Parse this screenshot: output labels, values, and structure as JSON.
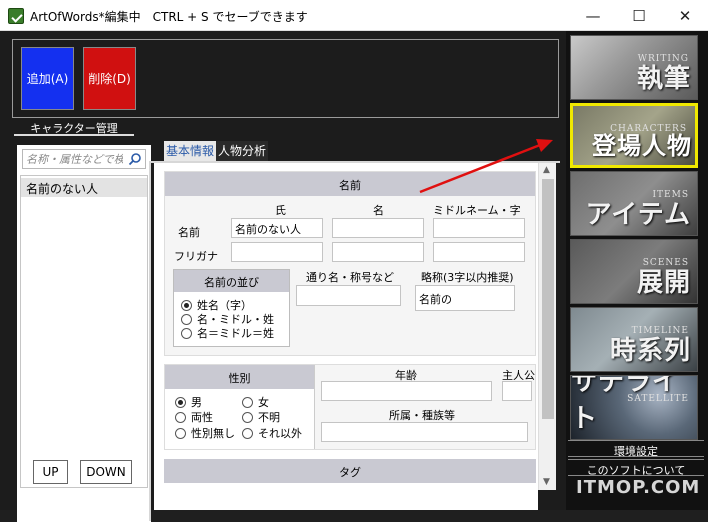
{
  "window": {
    "title": "ArtOfWords*編集中　CTRL + S でセーブできます",
    "minimize": "—",
    "maximize": "☐",
    "close": "✕"
  },
  "toolbar": {
    "add_label": "追加(A)",
    "delete_label": "削除(D)"
  },
  "character_manager": {
    "label": "キャラクター管理",
    "search_placeholder": "名称・属性などで検索",
    "list": [
      "名前のない人"
    ],
    "up_label": "UP",
    "down_label": "DOWN"
  },
  "tabs": [
    {
      "label": "基本情報",
      "active": true
    },
    {
      "label": "人物分析",
      "active": false
    }
  ],
  "name_section": {
    "header": "名前",
    "col_family": "氏",
    "col_given": "名",
    "col_middle": "ミドルネーム・字",
    "row_name": "名前",
    "row_furigana": "フリガナ",
    "family_value": "名前のない人",
    "given_value": "",
    "middle_value": "",
    "furigana_family": "",
    "furigana_given": "",
    "furigana_middle": "",
    "order_title": "名前の並び",
    "order_options": [
      "姓名（字）",
      "名・ミドル・姓",
      "名＝ミドル＝姓"
    ],
    "order_selected": 0,
    "alias_label": "通り名・称号など",
    "alias_value": "",
    "abbr_label": "略称(3字以内推奨)",
    "abbr_value": "名前の"
  },
  "gender_section": {
    "title": "性別",
    "options": [
      "男",
      "女",
      "両性",
      "不明",
      "性別無し",
      "それ以外"
    ],
    "selected": 0,
    "age_label": "年齢",
    "age_value": "",
    "protagonist_label": "主人公",
    "affiliation_label": "所属・種族等",
    "affiliation_value": ""
  },
  "tag_section": {
    "header": "タグ"
  },
  "nav": {
    "writing_en": "WRITING",
    "writing_jp": "執筆",
    "characters_en": "CHARACTERS",
    "characters_jp": "登場人物",
    "items_en": "ITEMS",
    "items_jp": "アイテム",
    "scenes_en": "SCENES",
    "scenes_jp": "展開",
    "timeline_en": "TIMELINE",
    "timeline_jp": "時系列",
    "satellite_en": "SATELLITE",
    "satellite_jp": "サテライト",
    "settings": "環境設定",
    "about": "このソフトについて"
  },
  "watermark": "ITMOP.COM",
  "colors": {
    "add_button": "#1430f0",
    "delete_button": "#d01010",
    "active_tile_border": "#f0e800",
    "arrow": "#e01010"
  }
}
